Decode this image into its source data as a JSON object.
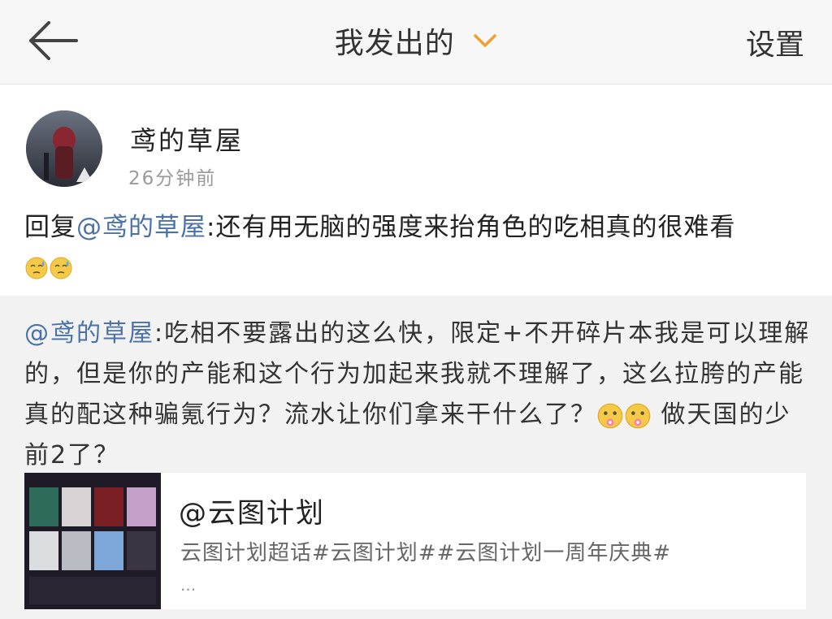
{
  "header": {
    "back_icon": "arrow-left-icon",
    "title": "我发出的",
    "dropdown_icon": "chevron-down-icon",
    "settings_label": "设置",
    "accent_color": "#f0a030"
  },
  "post": {
    "username": "鸢的草屋",
    "timestamp": "26分钟前",
    "reply_prefix": "回复",
    "reply_mention": "@鸢的草屋",
    "reply_body": ":还有用无脑的强度来抬角色的吃相真的很难看",
    "reply_emojis": [
      "sweat-emoji",
      "sweat-emoji"
    ]
  },
  "quoted": {
    "mention": "@鸢的草屋",
    "body_part1": ":吃相不要露出的这么快，限定+不开碎片本我是可以理解的，但是你的产能和这个行为加起来我就不理解了，这么拉胯的产能真的配这种骗氪行为？流水让你们拿来干什么了？",
    "emojis": [
      "flower-face-emoji",
      "flower-face-emoji"
    ],
    "body_part2": "做天国的少前2了？",
    "card": {
      "title": "@云图计划",
      "tags": "云图计划超话#云图计划##云图计划一周年庆典#",
      "more": "..."
    }
  }
}
